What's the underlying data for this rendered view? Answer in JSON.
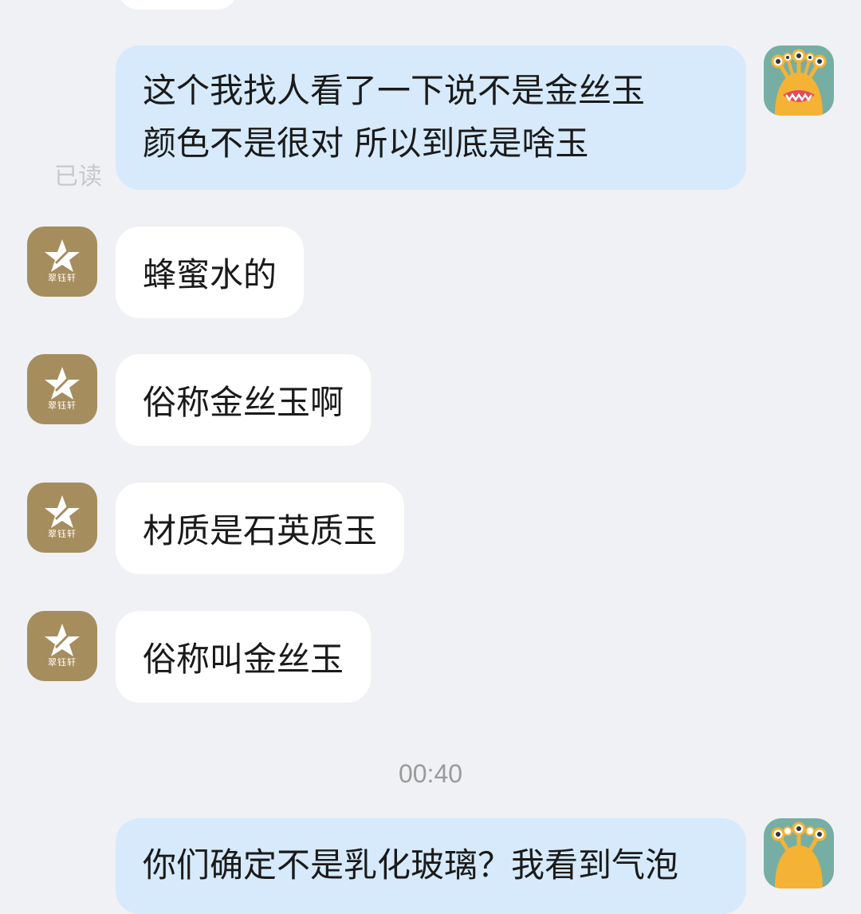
{
  "chat": {
    "messages": [
      {
        "side": "out",
        "lines": [
          "这个我找人看了一下说不是金丝玉",
          "颜色不是很对 所以到底是啥玉"
        ],
        "status": "已读"
      },
      {
        "side": "in",
        "text": "蜂蜜水的"
      },
      {
        "side": "in",
        "text": "俗称金丝玉啊"
      },
      {
        "side": "in",
        "text": "材质是石英质玉"
      },
      {
        "side": "in",
        "text": "俗称叫金丝玉"
      },
      {
        "side": "out",
        "lines": [
          "你们确定不是乳化玻璃？我看到气泡"
        ]
      }
    ],
    "timestamp": "00:40"
  },
  "contact": {
    "avatar_brand_text": "翠钰轩",
    "avatar_icon": "star-logo-icon"
  },
  "me": {
    "avatar_icon": "monster-avatar-icon"
  },
  "colors": {
    "background": "#f0f1f5",
    "incoming_bubble": "#ffffff",
    "outgoing_bubble": "#d6eafb",
    "brand_avatar": "#a68d5e",
    "monster_avatar": "#77aea3"
  }
}
